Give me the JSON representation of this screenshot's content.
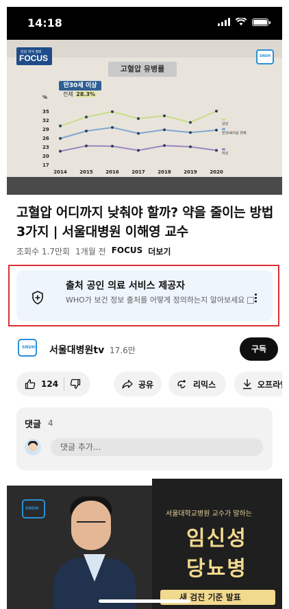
{
  "status_bar": {
    "time": "14:18"
  },
  "video": {
    "logo_small": "건강 지식 정보",
    "logo_text": "FOCUS",
    "tv_badge": "SNUH",
    "chart_title": "고혈압 유병률",
    "callout": "만30세 이상",
    "callout_sub": "전체",
    "callout_value": "28.3%",
    "chart_data": {
      "type": "line",
      "x": [
        2014,
        2015,
        2016,
        2017,
        2018,
        2019,
        2020
      ],
      "y_ticks": [
        17,
        20,
        23,
        26,
        29,
        32,
        35
      ],
      "y_unit": "%",
      "ylim": [
        17,
        35
      ],
      "series": [
        {
          "name": "만30세이상 전체",
          "color": "#7fa6cf",
          "values": [
            25.8,
            28.3,
            29.5,
            27.5,
            28.7,
            27.8,
            28.6
          ]
        },
        {
          "name": "남성",
          "color": "#c7dd84",
          "values": [
            30.0,
            33.0,
            34.8,
            32.5,
            33.4,
            31.2,
            35.0
          ]
        },
        {
          "name": "여성",
          "color": "#9a87c2",
          "values": [
            21.5,
            23.3,
            23.2,
            21.8,
            23.4,
            23.0,
            21.8
          ]
        }
      ]
    }
  },
  "title": "고혈압 어디까지 낮춰야 할까? 약을 줄이는 방법 3가지 | 서울대병원 이해영 교수",
  "meta": {
    "views": "조회수 1.7만회",
    "age": "1개월 전",
    "channel_tag": "FOCUS",
    "more": "더보기"
  },
  "info_panel": {
    "heading": "출처 공인 의료 서비스 제공자",
    "description": "WHO가 보건 정보 출처를 어떻게 정의하는지 알아보세요"
  },
  "channel": {
    "badge": "SNUH",
    "name": "서울대병원tv",
    "subscribers": "17.6만",
    "subscribe_label": "구독"
  },
  "actions": {
    "likes": "124",
    "share": "공유",
    "remix": "리믹스",
    "offline": "오프라인"
  },
  "comments": {
    "label": "댓글",
    "count": "4",
    "placeholder": "댓글 추가..."
  },
  "next_video": {
    "badge": "SNUH",
    "subtitle": "서울대학교병원 교수가 말하는",
    "line1": "임신성",
    "line2": "당뇨병",
    "strip": "새 검진 기준 발표"
  }
}
